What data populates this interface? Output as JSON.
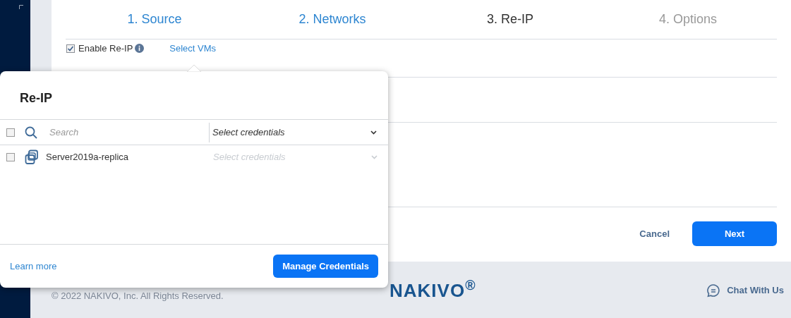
{
  "steps": [
    {
      "label": "1. Source",
      "completed": true,
      "selected": false
    },
    {
      "label": "2. Networks",
      "completed": true,
      "selected": false
    },
    {
      "label": "3. Re-IP",
      "completed": false,
      "selected": true
    },
    {
      "label": "4. Options",
      "completed": false,
      "selected": false
    }
  ],
  "enable_reip": {
    "label": "Enable Re-IP",
    "checked": true
  },
  "select_vms_link": "Select VMs",
  "actions": {
    "cancel": "Cancel",
    "next": "Next"
  },
  "footer": {
    "copyright": "© 2022 NAKIVO, Inc. All Rights Reserved.",
    "logo": "NAKIVO$^{®}$",
    "chat": "Chat With Us"
  },
  "popup": {
    "title": "Re-IP",
    "header": {
      "checked": false,
      "search_placeholder": "Search",
      "credentials": "Select credentials"
    },
    "rows": [
      {
        "name": "Server2019a-replica",
        "checked": false,
        "credentials_placeholder": "Select credentials",
        "disabled": true
      }
    ],
    "learn_more": "Learn more",
    "manage_button": "Manage Credentials"
  }
}
